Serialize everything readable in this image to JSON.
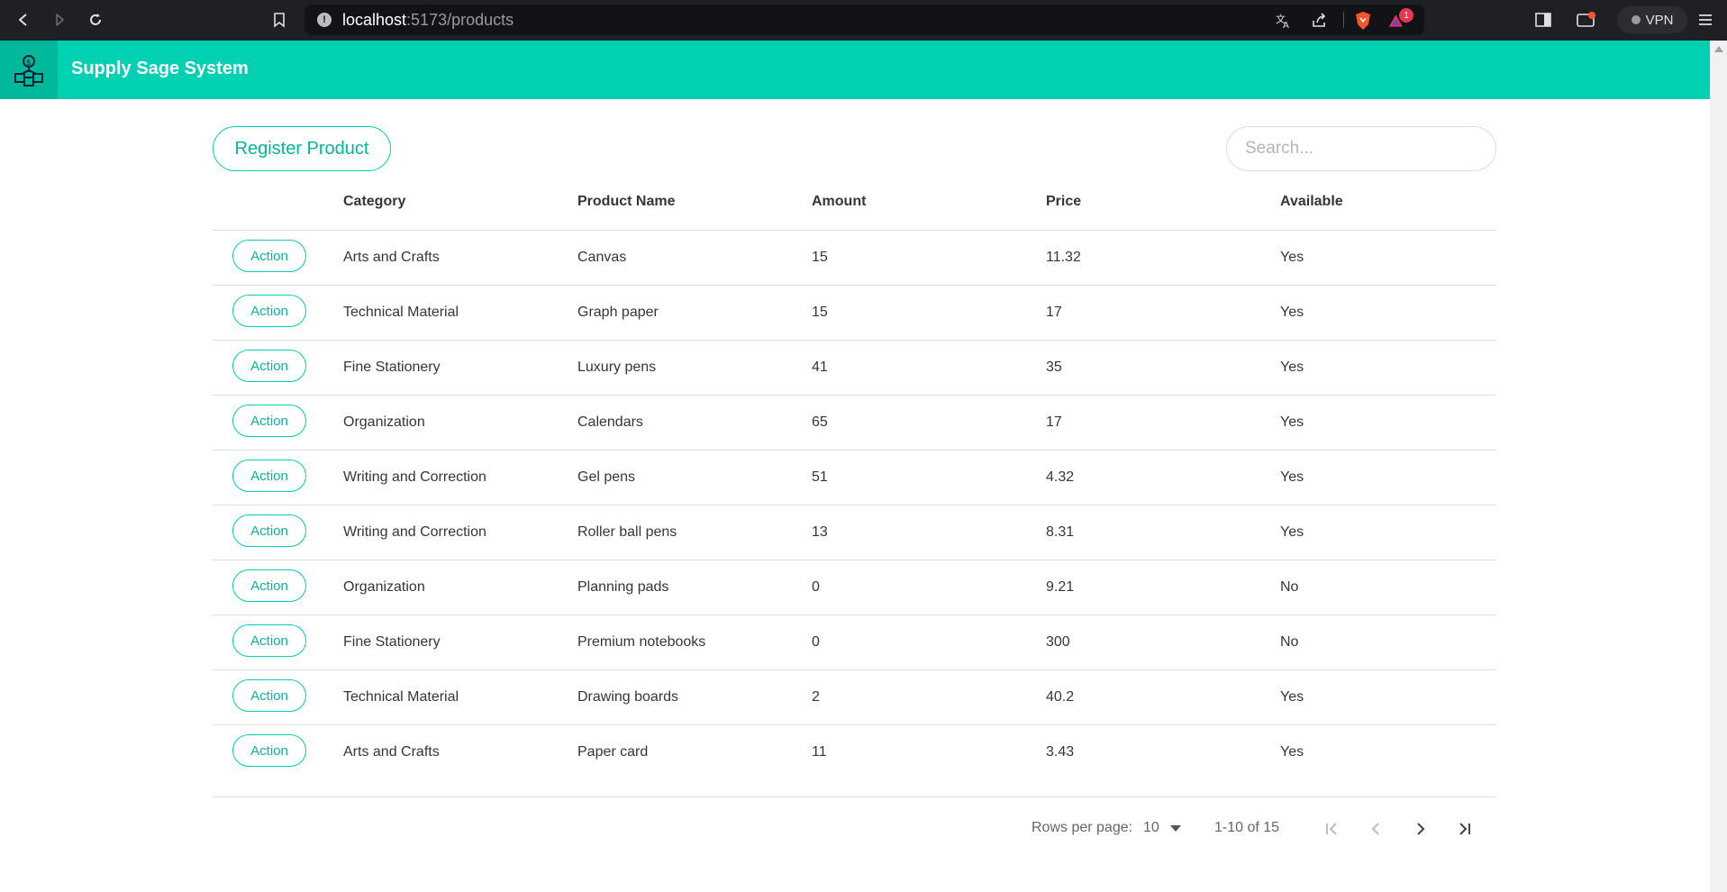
{
  "browser": {
    "url_host": "localhost",
    "url_path": ":5173/products",
    "vpn_label": "VPN",
    "notification_count": "1"
  },
  "app": {
    "title": "Supply Sage System"
  },
  "toolbar": {
    "register_label": "Register Product",
    "search_placeholder": "Search..."
  },
  "table": {
    "headers": {
      "category": "Category",
      "product_name": "Product Name",
      "amount": "Amount",
      "price": "Price",
      "available": "Available"
    },
    "action_label": "Action",
    "rows": [
      {
        "category": "Arts and Crafts",
        "name": "Canvas",
        "amount": "15",
        "price": "11.32",
        "available": "Yes"
      },
      {
        "category": "Technical Material",
        "name": "Graph paper",
        "amount": "15",
        "price": "17",
        "available": "Yes"
      },
      {
        "category": "Fine Stationery",
        "name": "Luxury pens",
        "amount": "41",
        "price": "35",
        "available": "Yes"
      },
      {
        "category": "Organization",
        "name": "Calendars",
        "amount": "65",
        "price": "17",
        "available": "Yes"
      },
      {
        "category": "Writing and Correction",
        "name": "Gel pens",
        "amount": "51",
        "price": "4.32",
        "available": "Yes"
      },
      {
        "category": "Writing and Correction",
        "name": "Roller ball pens",
        "amount": "13",
        "price": "8.31",
        "available": "Yes"
      },
      {
        "category": "Organization",
        "name": "Planning pads",
        "amount": "0",
        "price": "9.21",
        "available": "No"
      },
      {
        "category": "Fine Stationery",
        "name": "Premium notebooks",
        "amount": "0",
        "price": "300",
        "available": "No"
      },
      {
        "category": "Technical Material",
        "name": "Drawing boards",
        "amount": "2",
        "price": "40.2",
        "available": "Yes"
      },
      {
        "category": "Arts and Crafts",
        "name": "Paper card",
        "amount": "11",
        "price": "3.43",
        "available": "Yes"
      }
    ]
  },
  "pagination": {
    "rows_per_page_label": "Rows per page:",
    "rows_per_page_value": "10",
    "range_label": "1-10 of 15"
  },
  "colors": {
    "accent": "#00d1b2",
    "accent_dark": "#00b89c",
    "chrome_bg": "#1f2023"
  }
}
